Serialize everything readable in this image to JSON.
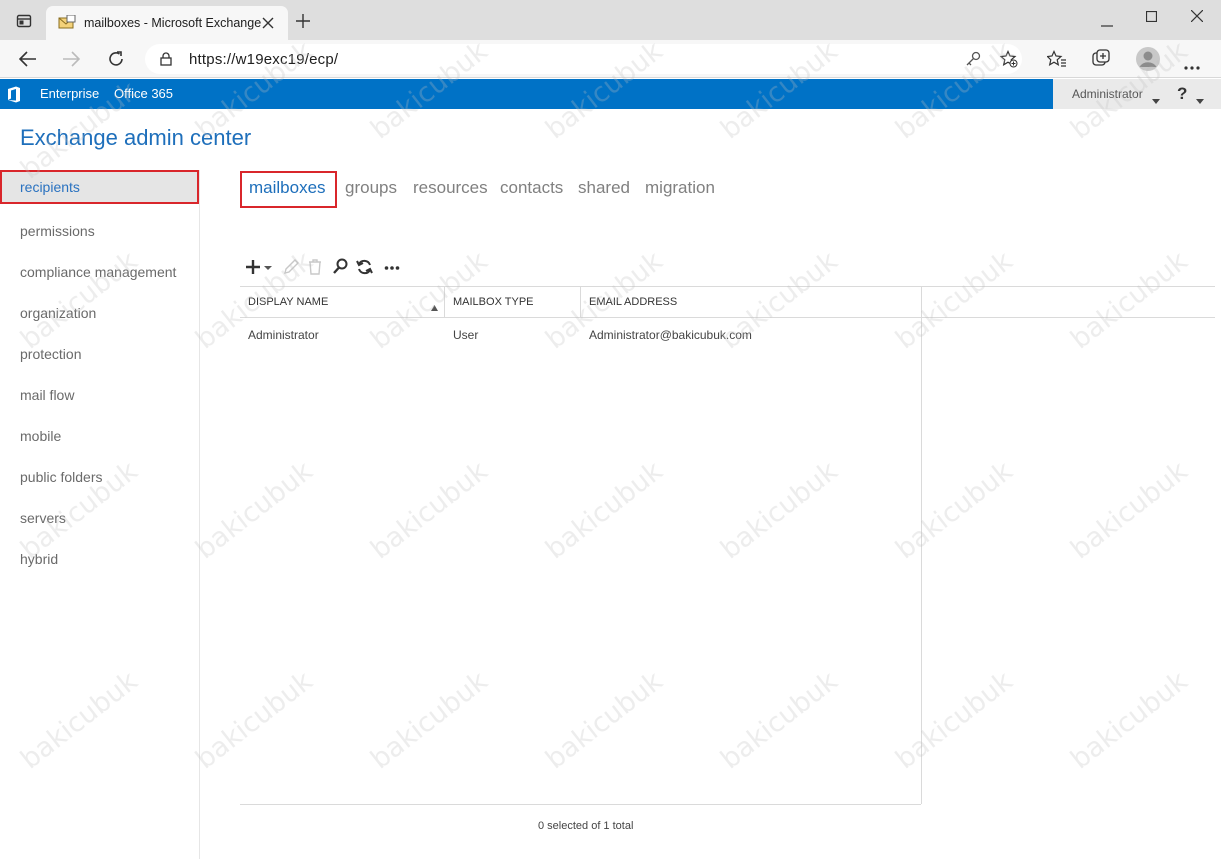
{
  "browser": {
    "tab_title": "mailboxes - Microsoft Exchange",
    "url": "https://w19exc19/ecp/"
  },
  "topbar": {
    "links": [
      "Enterprise",
      "Office 365"
    ],
    "user": "Administrator",
    "help": "?"
  },
  "app_title": "Exchange admin center",
  "nav": {
    "items": [
      "recipients",
      "permissions",
      "compliance management",
      "organization",
      "protection",
      "mail flow",
      "mobile",
      "public folders",
      "servers",
      "hybrid"
    ],
    "selected": "recipients"
  },
  "subtabs": [
    "mailboxes",
    "groups",
    "resources",
    "contacts",
    "shared",
    "migration"
  ],
  "table": {
    "columns": [
      "DISPLAY NAME",
      "MAILBOX TYPE",
      "EMAIL ADDRESS"
    ],
    "rows": [
      [
        "Administrator",
        "User",
        "Administrator@bakicubuk.com"
      ]
    ],
    "status": "0 selected of 1 total"
  },
  "watermark": "bakicubuk",
  "colors": {
    "accent_blue": "#0072c6",
    "title_blue": "#1e6fbb",
    "highlight_red": "#d9262b"
  }
}
